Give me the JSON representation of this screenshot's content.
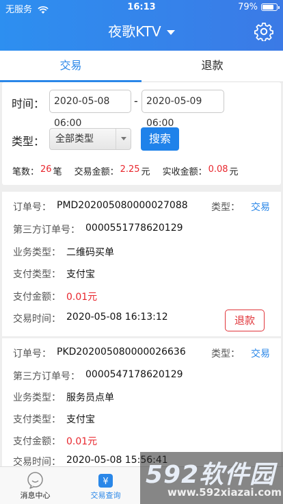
{
  "status_bar": {
    "carrier": "无服务",
    "time": "16:13",
    "battery": "79%",
    "battery_level": 0.79
  },
  "header": {
    "title": "夜歌KTV"
  },
  "tabs": [
    {
      "label": "交易",
      "active": true
    },
    {
      "label": "退款",
      "active": false
    }
  ],
  "filter": {
    "time_label": "时间：",
    "start_time": "2020-05-08 06:00",
    "end_time": "2020-05-09 06:00",
    "dash": "-",
    "type_label": "类型：",
    "type_selected": "全部类型",
    "search_label": "搜索"
  },
  "summary": {
    "count_label": "笔数：",
    "count_value": "26",
    "count_unit": "笔",
    "amount_label": "交易金额：",
    "amount_value": "2.25",
    "amount_unit": "元",
    "received_label": "实收金额：",
    "received_value": "0.08",
    "received_unit": "元"
  },
  "orders": [
    {
      "order_label": "订单号：",
      "order_no": "PMD202005080000027088",
      "type_label": "类型：",
      "type_value": "交易",
      "third_label": "第三方订单号：",
      "third_no": "0000551778620129",
      "biz_label": "业务类型：",
      "biz_value": "二维码买单",
      "pay_label": "支付类型：",
      "pay_value": "支付宝",
      "amount_label": "支付金额：",
      "amount_value": "0.01元",
      "time_label": "交易时间：",
      "time_value": "2020-05-08 16:13:12",
      "refund_label": "退款"
    },
    {
      "order_label": "订单号：",
      "order_no": "PKD202005080000026636",
      "type_label": "类型：",
      "type_value": "交易",
      "third_label": "第三方订单号：",
      "third_no": "0000547178620129",
      "biz_label": "业务类型：",
      "biz_value": "服务员点单",
      "pay_label": "支付类型：",
      "pay_value": "支付宝",
      "amount_label": "支付金额：",
      "amount_value": "0.01元",
      "time_label": "交易时间：",
      "time_value": "2020-05-08 15:56:41"
    }
  ],
  "bottom_nav": [
    {
      "label": "消息中心",
      "icon": "message-icon",
      "active": false
    },
    {
      "label": "交易查询",
      "icon": "yuan-icon",
      "active": true
    }
  ],
  "watermark": {
    "brand": "592软件园",
    "url": "www.592xiazai.com"
  },
  "colors": {
    "primary": "#2a87e8",
    "red": "#e8262d"
  }
}
